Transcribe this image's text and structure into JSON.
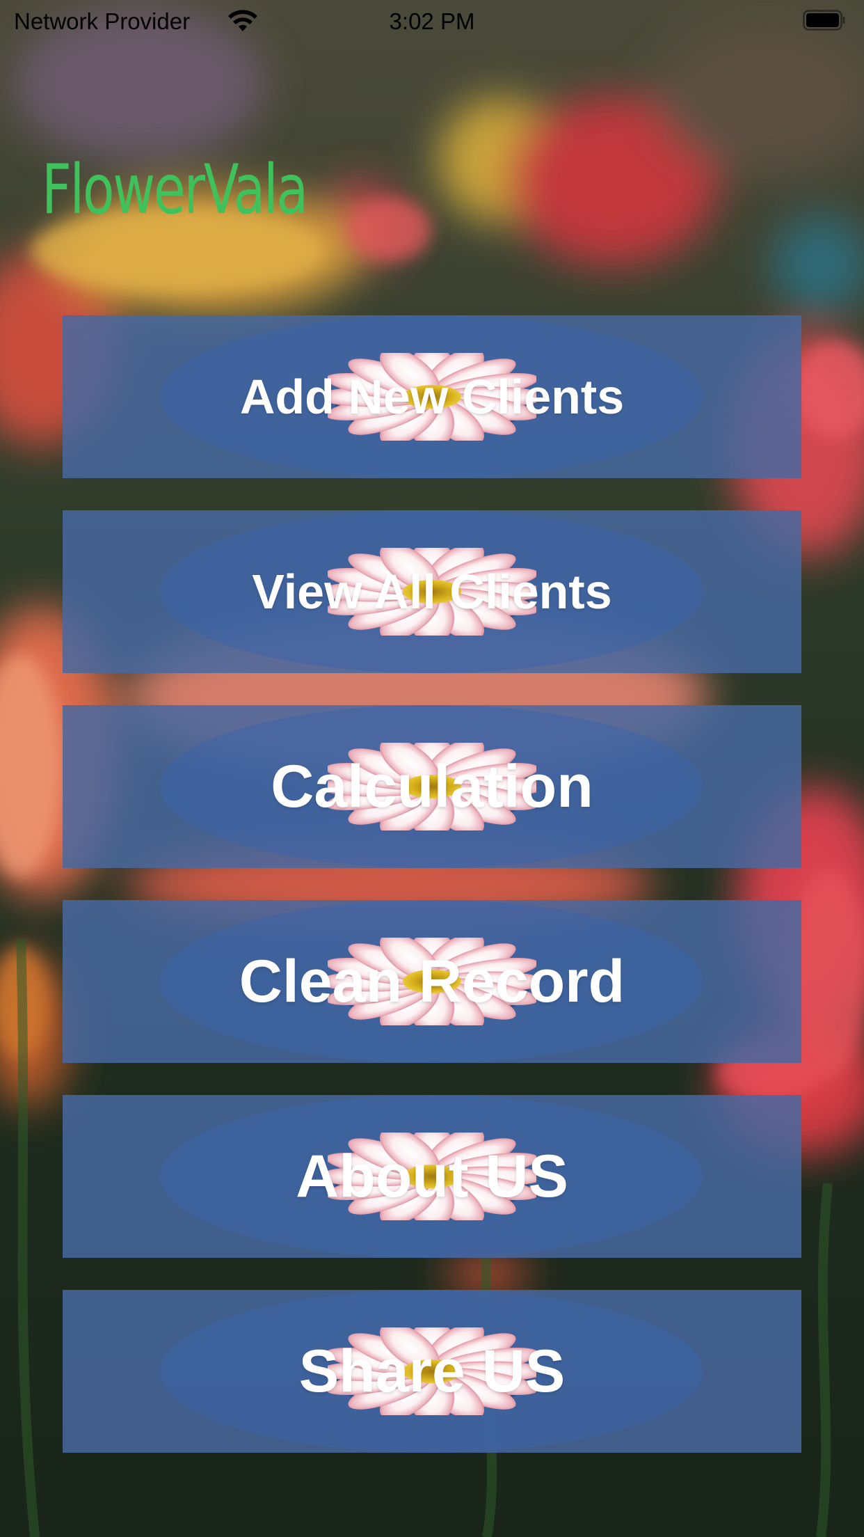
{
  "status_bar": {
    "carrier": "Network Provider",
    "time": "3:02 PM",
    "wifi_icon": "wifi-icon",
    "battery_icon": "battery-icon"
  },
  "app": {
    "title": "FlowerVala",
    "title_color": "#3fc25c"
  },
  "menu": {
    "button_color": "#4868a0",
    "label_color": "#ffffff",
    "button_icon": "daisy-flower-icon",
    "items": [
      {
        "label": "Add New Clients"
      },
      {
        "label": "View All Clients"
      },
      {
        "label": "Calculation"
      },
      {
        "label": "Clean Record"
      },
      {
        "label": "About US"
      },
      {
        "label": "Share US"
      }
    ]
  }
}
